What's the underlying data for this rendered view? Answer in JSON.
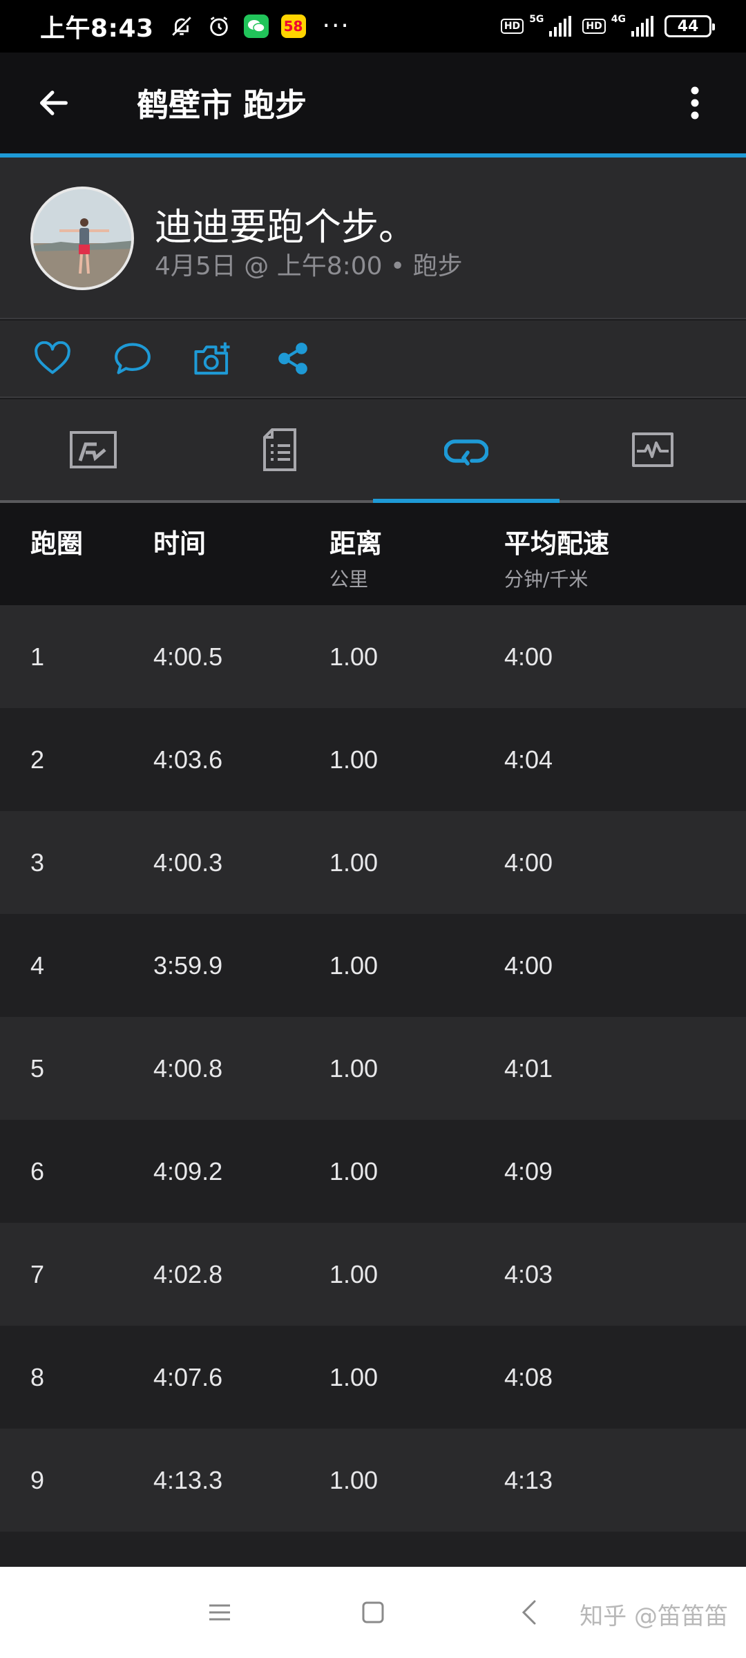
{
  "status_bar": {
    "time": "上午8:43",
    "icons": [
      "bell-off-icon",
      "alarm-icon",
      "wechat-icon",
      "app-58-icon",
      "more-dots-icon"
    ],
    "app58_label": "58",
    "more_dots": "···",
    "hd1": "HD",
    "net1": "5G",
    "hd2": "HD",
    "net2": "4G",
    "battery": "44"
  },
  "app_bar": {
    "title": "鹤壁市 跑步",
    "back_icon": "arrow-left-icon",
    "more_icon": "more-vertical-icon"
  },
  "activity": {
    "title": "迪迪要跑个步。",
    "meta": "4月5日 @ 上午8:00 • 跑步"
  },
  "social": [
    "heart-icon",
    "comment-icon",
    "camera-add-icon",
    "share-icon"
  ],
  "tabs": [
    {
      "icon": "map-icon",
      "active": false
    },
    {
      "icon": "stats-document-icon",
      "active": false
    },
    {
      "icon": "laps-icon",
      "active": true
    },
    {
      "icon": "chart-icon",
      "active": false
    }
  ],
  "table": {
    "headers": [
      {
        "label": "跑圈",
        "unit": ""
      },
      {
        "label": "时间",
        "unit": ""
      },
      {
        "label": "距离",
        "unit": "公里"
      },
      {
        "label": "平均配速",
        "unit": "分钟/千米"
      }
    ],
    "rows": [
      {
        "lap": "1",
        "time": "4:00.5",
        "distance": "1.00",
        "pace": "4:00"
      },
      {
        "lap": "2",
        "time": "4:03.6",
        "distance": "1.00",
        "pace": "4:04"
      },
      {
        "lap": "3",
        "time": "4:00.3",
        "distance": "1.00",
        "pace": "4:00"
      },
      {
        "lap": "4",
        "time": "3:59.9",
        "distance": "1.00",
        "pace": "4:00"
      },
      {
        "lap": "5",
        "time": "4:00.8",
        "distance": "1.00",
        "pace": "4:01"
      },
      {
        "lap": "6",
        "time": "4:09.2",
        "distance": "1.00",
        "pace": "4:09"
      },
      {
        "lap": "7",
        "time": "4:02.8",
        "distance": "1.00",
        "pace": "4:03"
      },
      {
        "lap": "8",
        "time": "4:07.6",
        "distance": "1.00",
        "pace": "4:08"
      },
      {
        "lap": "9",
        "time": "4:13.3",
        "distance": "1.00",
        "pace": "4:13"
      }
    ]
  },
  "nav_bar": {
    "buttons": [
      "menu-icon",
      "home-square-icon",
      "back-chevron-icon"
    ],
    "watermark": "知乎 @笛笛笛"
  },
  "colors": {
    "accent": "#1e9ad6",
    "background": "#1c1c1e"
  }
}
